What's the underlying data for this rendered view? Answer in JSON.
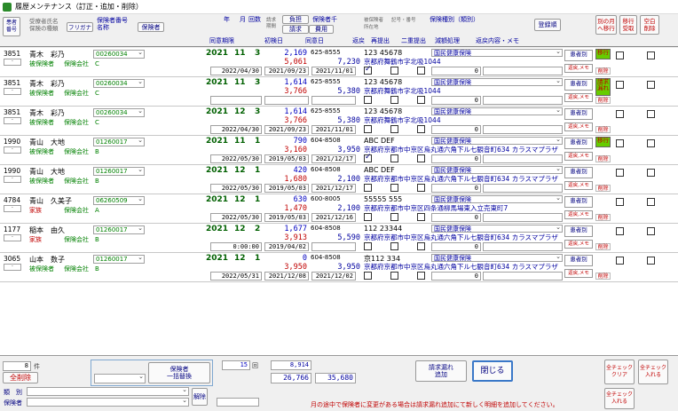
{
  "window": {
    "title": "履歴メンテナンス（訂正・追加・削除）"
  },
  "header": {
    "patient_no_top": "患者",
    "patient_no_bottom": "番号",
    "name_top": "受療者氏名",
    "name_bottom": "保険の種類",
    "furigana": "フリガナ",
    "insurer_no_top": "保険者番号",
    "insurer_no_bottom": "名称",
    "insurer_button": "保険者",
    "year": "年",
    "month": "月",
    "count": "回数",
    "request_top": "請求",
    "request_bottom": "期間",
    "period_label": "同意期限",
    "initial_date": "初検日",
    "consent_date": "同意日",
    "burden_ratio": "負担",
    "claim": "請求",
    "amount_label": "保険者千",
    "cost_button": "費用",
    "symbol_label": "被保険者",
    "symbol_sub": "所在地",
    "symbol_number": "記号・番号",
    "return_label": "返戻",
    "resubmit_label": "再提出",
    "double_label": "二重提出",
    "insurance_type": "保険種別（類別）",
    "reduction": "減額処理",
    "return_detail": "返戻内容・メモ",
    "register_button": "登録順",
    "other_month_top": "別の月",
    "other_month_bottom": "へ移行",
    "move_top": "移行",
    "move_bottom": "受取",
    "delete_top": "空白",
    "delete_bottom": "削除"
  },
  "rows": [
    {
      "no": "3851",
      "name": "青木　彩乃",
      "type": "被保険者",
      "insurer_code": "00260034",
      "insurer_name": "保険会社　C",
      "year": "2021",
      "month": "11",
      "count": "3",
      "period": "2022/04/30",
      "amount1": "2,169",
      "amount2": "5,061",
      "total": "7,230",
      "zip": "625-8555",
      "initial": "2021/09/23",
      "consent": "2021/11/01",
      "symbol": "123 45678",
      "address": "京都府舞鶴市字北吸1044",
      "ins_type": "国民健康保険",
      "reduction": "0",
      "ret": false,
      "resub": false,
      "double": false,
      "move_label": "移行",
      "move_badge": true,
      "check2": false,
      "check3": false,
      "check_ret_on": true
    },
    {
      "no": "3851",
      "name": "青木　彩乃",
      "type": "被保険者",
      "insurer_code": "00260034",
      "insurer_name": "保険会社　C",
      "year": "2021",
      "month": "11",
      "count": "3",
      "period": "",
      "amount1": "1,614",
      "amount2": "3,766",
      "total": "5,380",
      "zip": "625-8555",
      "initial": "",
      "consent": "",
      "symbol": "123 45678",
      "address": "京都府舞鶴市字北吸1044",
      "ins_type": "国民健康保険",
      "reduction": "0",
      "move_label": "請求\n漏れ",
      "move_badge": true,
      "check_ret_on": false
    },
    {
      "no": "3851",
      "name": "青木　彩乃",
      "type": "被保険者",
      "insurer_code": "00260034",
      "insurer_name": "保険会社　C",
      "year": "2021",
      "month": "12",
      "count": "3",
      "period": "2022/04/30",
      "amount1": "1,614",
      "amount2": "3,766",
      "total": "5,380",
      "zip": "625-8555",
      "initial": "2021/09/23",
      "consent": "2021/11/01",
      "symbol": "123 45678",
      "address": "京都府舞鶴市字北吸1044",
      "ins_type": "国民健康保険",
      "reduction": "0",
      "move_label": "",
      "move_badge": false,
      "check_ret_on": false
    },
    {
      "no": "1990",
      "name": "青山　大地",
      "type": "被保険者",
      "insurer_code": "01260017",
      "insurer_name": "保険会社　B",
      "year": "2021",
      "month": "11",
      "count": "1",
      "period": "2022/05/30",
      "amount1": "790",
      "amount2": "3,160",
      "total": "3,950",
      "zip": "604-8508",
      "initial": "2019/05/03",
      "consent": "2021/12/17",
      "symbol": "ABC DEF",
      "address": "京都府京都市中京区烏丸通六角下ル七観音町634 カラスマプラザ",
      "ins_type": "国民健康保険",
      "reduction": "0",
      "move_label": "移行",
      "move_badge": true,
      "check_ret_on": true
    },
    {
      "no": "1990",
      "name": "青山　大地",
      "type": "被保険者",
      "insurer_code": "01260017",
      "insurer_name": "保険会社　B",
      "year": "2021",
      "month": "12",
      "count": "1",
      "period": "2022/05/30",
      "amount1": "420",
      "amount2": "1,680",
      "total": "2,100",
      "zip": "604-8508",
      "initial": "2019/05/03",
      "consent": "2021/12/17",
      "symbol": "ABC DEF",
      "address": "京都府京都市中京区烏丸通六角下ル七観音町634 カラスマプラザ",
      "ins_type": "国民健康保険",
      "reduction": "0",
      "move_label": "",
      "move_badge": false,
      "check_ret_on": false
    },
    {
      "no": "4784",
      "name": "青山　久美子",
      "type": "家族",
      "insurer_code": "06260509",
      "insurer_name": "保険会社　A",
      "year": "2021",
      "month": "12",
      "count": "1",
      "period": "2022/05/30",
      "amount1": "630",
      "amount2": "1,470",
      "total": "2,100",
      "zip": "600-8005",
      "initial": "2019/05/03",
      "consent": "2021/12/16",
      "symbol": "55555 555",
      "address": "京都府京都市中京区四条通柳馬場東入立売東町7",
      "ins_type": "国民健康保険",
      "reduction": "0",
      "move_label": "",
      "move_badge": false,
      "check_ret_on": false
    },
    {
      "no": "1177",
      "name": "稲本　由久",
      "type": "家族",
      "insurer_code": "01260017",
      "insurer_name": "保険会社　B",
      "year": "2021",
      "month": "12",
      "count": "2",
      "period": "0:00:00",
      "amount1": "1,677",
      "amount2": "3,913",
      "total": "5,590",
      "zip": "604-8508",
      "initial": "2019/04/02",
      "consent": "",
      "symbol": "112 23344",
      "address": "京都府京都市中京区烏丸通六角下ル七観音町634 カラスマプラザ",
      "ins_type": "国民健康保険",
      "reduction": "0",
      "move_label": "",
      "move_badge": false,
      "check_ret_on": false
    },
    {
      "no": "3065",
      "name": "山本　数子",
      "type": "被保険者",
      "insurer_code": "01260017",
      "insurer_name": "保険会社　B",
      "year": "2021",
      "month": "12",
      "count": "1",
      "period": "2022/05/31",
      "amount1": "0",
      "amount2": "3,950",
      "total": "3,950",
      "zip": "604-8508",
      "initial": "2021/12/08",
      "consent": "2021/12/02",
      "symbol": "京112 334",
      "address": "京都府京都市中京区烏丸通六角下ル七観音町634 カラスマプラザ",
      "ins_type": "国民健康保険",
      "reduction": "0",
      "move_label": "",
      "move_badge": false,
      "check_ret_on": false
    }
  ],
  "row_buttons": {
    "patient": "患者別",
    "memo": "返戻,メモ",
    "delete": "削除"
  },
  "footer": {
    "count": "8",
    "count_unit": "件",
    "delete_all": "全削除",
    "insurer_bulk_top": "保険者",
    "insurer_bulk_bottom": "一括替換",
    "pages": "15",
    "page_unit": "回",
    "sum1": "8,914",
    "sum2": "26,766",
    "sum3": "35,680",
    "missing_top": "請求漏れ",
    "missing_bottom": "追加",
    "close": "閉じる",
    "category": "類　別",
    "insurer": "保険者",
    "release": "解除",
    "notice": "月の途中で保険者に変更がある場合は請求漏れ追加にて新しく明細を追加してください。",
    "check_clear": "全チェック\nクリア",
    "check_enter": "全チェック\n入れる",
    "check_enter2": "全チェック\n入れる",
    "check_enter3": "全チェック\n入れる"
  }
}
